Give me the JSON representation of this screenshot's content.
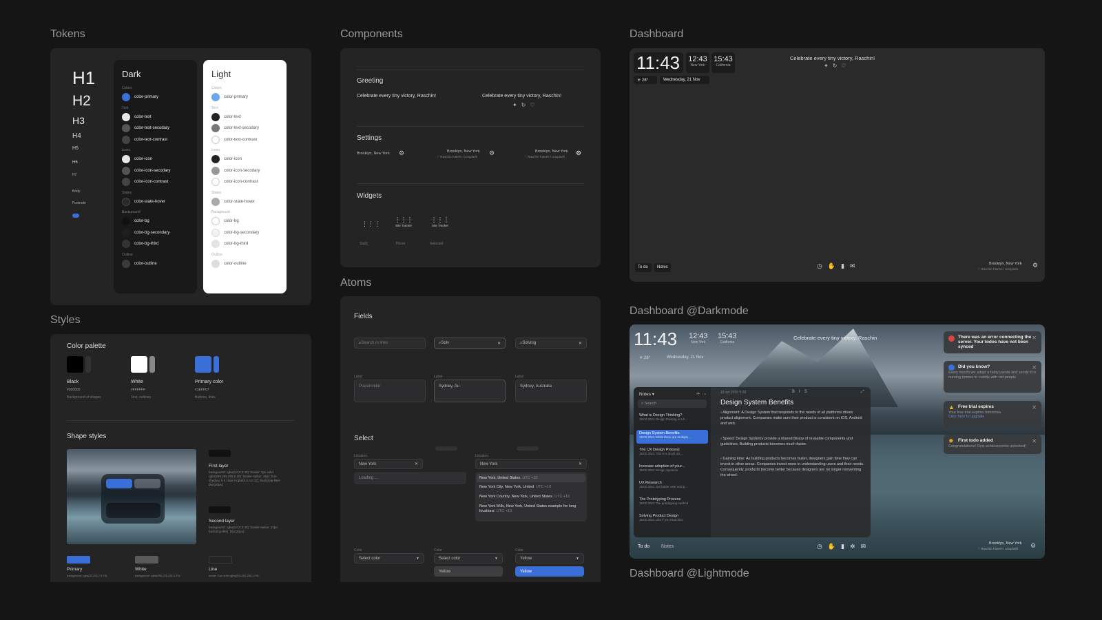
{
  "sections": {
    "tokens": "Tokens",
    "components": "Components",
    "dashboard": "Dashboard",
    "styles": "Styles",
    "atoms": "Atoms",
    "dashboard_dark": "Dashboard @Darkmode",
    "dashboard_light": "Dashboard @Lightmode"
  },
  "tokens": {
    "headings": [
      "H1",
      "H2",
      "H3",
      "H4",
      "H5",
      "H6",
      "H7",
      "Body",
      "Footnote"
    ],
    "dark_title": "Dark",
    "light_title": "Light",
    "cat_colors": "Colors",
    "cat_text": "Text",
    "cat_icons": "Icons",
    "cat_states": "States",
    "cat_background": "Background",
    "cat_outline": "Outline",
    "color_primary": "color-primary",
    "color_text": "color-text",
    "color_text_secondary": "color-text-secodary",
    "color_text_contrast": "color-text-contrast",
    "color_icon": "color-icon",
    "color_icon_secondary": "color-icon-secodary",
    "color_icon_contrast": "color-icon-contrast",
    "color_state_hover": "color-state-hover",
    "color_bg": "color-bg",
    "color_bg_secondary": "color-bg-secondary",
    "color_bg_third": "color-bg-third",
    "color_outline": "color-outline"
  },
  "components": {
    "greeting_title": "Greeting",
    "greeting_text": "Celebrate every tiny victory, Raschin!",
    "settings_title": "Settings",
    "location": "Brooklyn, New York",
    "credit": "Raschin Fatemi / Unsplash",
    "widgets_title": "Widgets",
    "widget_label": "Site Tracker",
    "state_static": "Static",
    "state_hover": "Hover",
    "state_selected": "Selected"
  },
  "styles": {
    "palette_title": "Color palette",
    "black_name": "Black",
    "black_hex": "#000000",
    "black_use": "Background of shapes",
    "white_name": "White",
    "white_hex": "#FFFFFF",
    "white_use": "Text, outlines",
    "primary_name": "Primary color",
    "primary_hex": "#1EFF07",
    "primary_use": "Buttons, links",
    "shape_title": "Shape styles",
    "first_layer": "First layer",
    "first_layer_css": "background: rgba(0,0,0,0.40); border: 1px solid rgba(255,255,255,0.10); border-radius: 16px; box-shadow: 0 0 15px 0 rgba(0,0,0,0.32); backdrop-filter: blur(20px);",
    "second_layer": "Second layer",
    "second_layer_css": "background: rgba(0,0,0,0.40); border-radius: 12px; backdrop-filter: blur(20px);",
    "primary_label": "Primary",
    "primary_css": "background: rgba(30,255,7,0.70);",
    "white_label": "White",
    "white_css": "background: rgba(255,255,255,0.20);",
    "line_label": "Line",
    "line_css": "border: 1px solid rgba(255,255,255,0.10);"
  },
  "atoms": {
    "fields_title": "Fields",
    "search_placeholder": "Search in links",
    "search_typing": "Solv",
    "search_typed": "Solving",
    "label": "Label",
    "placeholder": "Placeholder",
    "val_typing": "Sydney, Au",
    "val_typed": "Sydney, Australia",
    "select_title": "Select",
    "location_label": "Location",
    "loc_value": "New York",
    "loading": "Loading ...",
    "options": [
      {
        "name": "New York, United States",
        "tz": "UTC +10"
      },
      {
        "name": "New York City, New York, United",
        "tz": "UTC +10"
      },
      {
        "name": "New York Country, New York, United States",
        "tz": "UTC +10"
      },
      {
        "name": "New York Mills, New York, United States example for long locations",
        "tz": "UTC +10"
      }
    ],
    "color_label": "Color",
    "select_color": "Select color",
    "yellow": "Yellow"
  },
  "dashboard": {
    "time_main": "11:43",
    "time_ny": "12:43",
    "city_ny": "New York",
    "time_ca": "15:43",
    "city_ca": "California",
    "weather": "28°",
    "date": "Wednesday, 21 Nov",
    "greeting": "Celebrate every tiny victory, Raschin!",
    "todo": "To do",
    "notes": "Notes",
    "location": "Brooklyn, New York",
    "credit": "Raschin Fatemi / Unsplash"
  },
  "dark": {
    "greeting": "Celebrate every tiny victory, Raschin",
    "notes_header": "Notes",
    "search": "Search",
    "notes": [
      {
        "title": "What is Design Thinking?",
        "meta": "19.02.2021  Design thinking is a h..."
      },
      {
        "title": "Design System Benefits",
        "meta": "19.02.2021  While there are multiple..."
      },
      {
        "title": "The UX Design Process",
        "meta": "19.02.2021  This is a short UX..."
      },
      {
        "title": "Increase adoption of your...",
        "meta": "19.02.2021  Design Systems"
      },
      {
        "title": "UX Research",
        "meta": "19.02.2021  Get better user and p..."
      },
      {
        "title": "The Prototyping Process",
        "meta": "19.02.2021  The prototyping method"
      },
      {
        "title": "Solving Product Design",
        "meta": "19.02.2021  Like if you read this!"
      }
    ],
    "doc_date": "19 oct 2020 5:29",
    "doc_title": "Design System Benefits",
    "doc_p1": "Alignment: A Design System that responds to the needs of all platforms drives product alignment. Companies make sure their product is consistent on iOS, Android and web.",
    "doc_p2": "Speed: Design Systems provide a shared library of reusable components and guidelines. Building products becomes much faster.",
    "doc_p3": "Gaining time: As building products becomes faster, designers gain time they can invest in other areas. Companies invest more in understanding users and their needs. Consequently, products become better because designers are no longer reinventing the wheel.",
    "n1_title": "There was an error connecting the server. Your todos have not been synced",
    "n2_title": "Did you know?",
    "n2_text": "Every month we adopt a baby panda and sends it to nursing homes to cuddle with old people",
    "n3_title": "Free trial expires",
    "n3_text": "Your free trial expires tomorrow",
    "n3_link": "Click here to upgrade",
    "n4_title": "First todo added",
    "n4_text": "Congratulations! First achievements unlocked!"
  },
  "colors": {
    "primary": "#3a6fd8",
    "bg": "#151516",
    "panel": "#242425"
  }
}
